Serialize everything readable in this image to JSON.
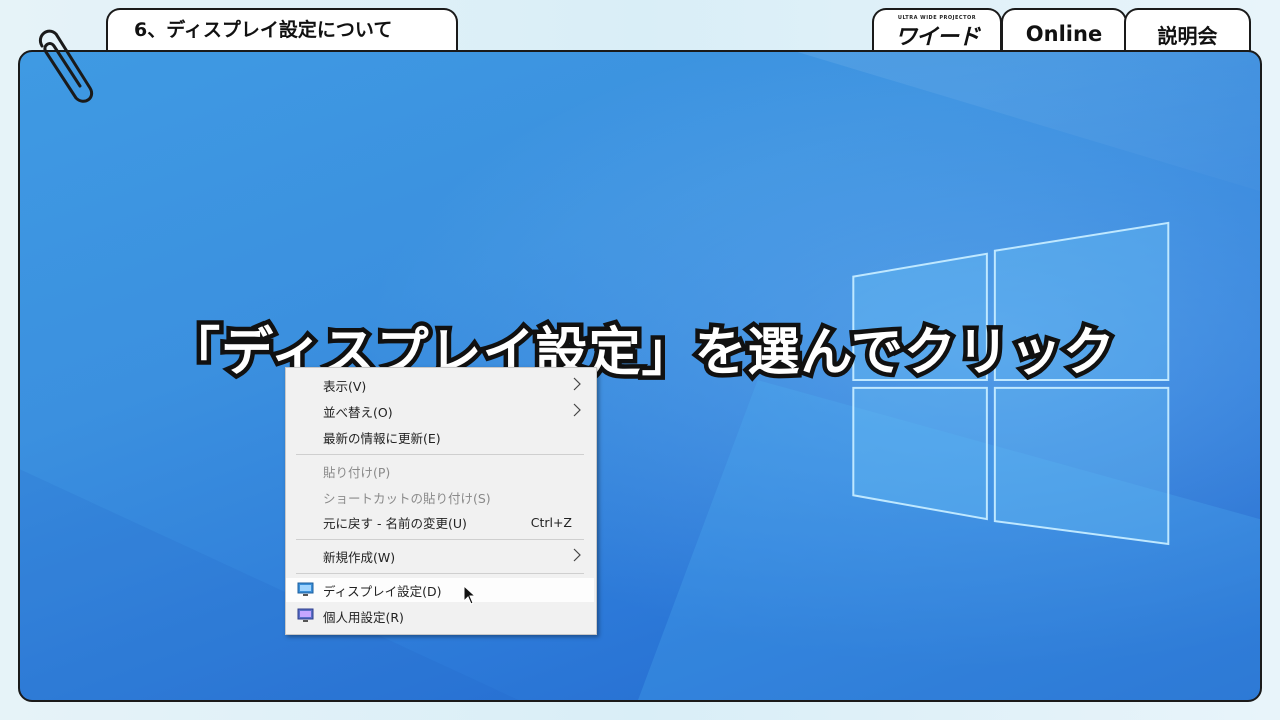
{
  "header": {
    "title": "6、ディスプレイ設定について",
    "brand_small": "ULTRA WIDE PROJECTOR",
    "brand_name": "ワイード",
    "online": "Online",
    "seminar": "説明会"
  },
  "headline": "「ディスプレイ設定」を選んでクリック",
  "context_menu": {
    "items": [
      {
        "label": "表示(V)",
        "submenu": true
      },
      {
        "label": "並べ替え(O)",
        "submenu": true
      },
      {
        "label": "最新の情報に更新(E)"
      },
      {
        "label": "貼り付け(P)",
        "disabled": true
      },
      {
        "label": "ショートカットの貼り付け(S)",
        "disabled": true
      },
      {
        "label": "元に戻す - 名前の変更(U)",
        "shortcut": "Ctrl+Z"
      },
      {
        "label": "新規作成(W)",
        "submenu": true
      },
      {
        "label": "ディスプレイ設定(D)",
        "icon": "display-icon",
        "highlighted": true
      },
      {
        "label": "個人用設定(R)",
        "icon": "personalize-icon"
      }
    ]
  },
  "colors": {
    "desktop_blue": "#3b90df",
    "menu_bg": "#f1f1f1",
    "disabled_text": "#8a8a8a"
  }
}
